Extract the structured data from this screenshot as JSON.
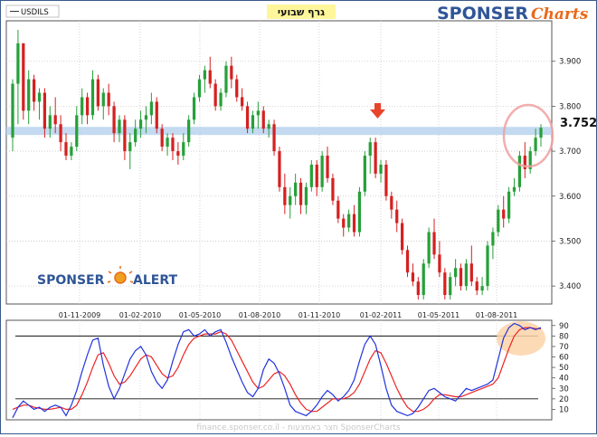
{
  "header": {
    "symbol": "USDILS",
    "title": "גרף שבועי",
    "brand_main": "SPONSER",
    "brand_accent": "Charts"
  },
  "alert_logo": {
    "left": "SPONSER",
    "right": "ALERT"
  },
  "footer": {
    "text": "finance.sponser.co.il - חצר באמצעות SponserCharts"
  },
  "colors": {
    "up": "#27a03a",
    "down": "#d42121",
    "stoch_k": "#2233dd",
    "stoch_d": "#ee2222",
    "resistance_band": "#b9d3ef",
    "marker": "#e8432b",
    "brand_blue": "#2f5597",
    "brand_orange": "#e86a1a"
  },
  "chart_data": [
    {
      "type": "candlestick",
      "series": [
        {
          "name": "USDILS"
        }
      ],
      "x_ticks": [
        "01-11-2009",
        "01-02-2010",
        "01-05-2010",
        "01-08-2010",
        "01-11-2010",
        "01-02-2011",
        "01-05-2011",
        "01-08-2011"
      ],
      "y_ticks": [
        "3.900",
        "3.800",
        "3.700",
        "3.600",
        "3.500",
        "3.400"
      ],
      "ylim": [
        3.36,
        3.99
      ],
      "last_price": "3.752",
      "resistance_level": 3.745,
      "grid": true,
      "candles": [
        [
          3.73,
          3.86,
          3.7,
          3.85
        ],
        [
          3.85,
          3.97,
          3.76,
          3.94
        ],
        [
          3.94,
          3.94,
          3.77,
          3.79
        ],
        [
          3.79,
          3.88,
          3.76,
          3.86
        ],
        [
          3.86,
          3.87,
          3.79,
          3.81
        ],
        [
          3.81,
          3.84,
          3.77,
          3.83
        ],
        [
          3.83,
          3.84,
          3.73,
          3.75
        ],
        [
          3.75,
          3.8,
          3.73,
          3.78
        ],
        [
          3.78,
          3.82,
          3.74,
          3.76
        ],
        [
          3.76,
          3.78,
          3.7,
          3.72
        ],
        [
          3.72,
          3.74,
          3.68,
          3.69
        ],
        [
          3.69,
          3.72,
          3.68,
          3.71
        ],
        [
          3.71,
          3.8,
          3.7,
          3.78
        ],
        [
          3.78,
          3.84,
          3.76,
          3.82
        ],
        [
          3.82,
          3.83,
          3.76,
          3.78
        ],
        [
          3.78,
          3.88,
          3.77,
          3.86
        ],
        [
          3.86,
          3.87,
          3.79,
          3.8
        ],
        [
          3.8,
          3.84,
          3.77,
          3.83
        ],
        [
          3.83,
          3.85,
          3.78,
          3.8
        ],
        [
          3.8,
          3.81,
          3.72,
          3.74
        ],
        [
          3.74,
          3.78,
          3.72,
          3.77
        ],
        [
          3.77,
          3.78,
          3.68,
          3.7
        ],
        [
          3.7,
          3.74,
          3.66,
          3.72
        ],
        [
          3.72,
          3.77,
          3.71,
          3.75
        ],
        [
          3.75,
          3.79,
          3.73,
          3.77
        ],
        [
          3.77,
          3.8,
          3.74,
          3.78
        ],
        [
          3.78,
          3.83,
          3.76,
          3.81
        ],
        [
          3.81,
          3.82,
          3.74,
          3.75
        ],
        [
          3.75,
          3.76,
          3.7,
          3.71
        ],
        [
          3.71,
          3.74,
          3.69,
          3.73
        ],
        [
          3.73,
          3.74,
          3.68,
          3.7
        ],
        [
          3.7,
          3.72,
          3.67,
          3.69
        ],
        [
          3.69,
          3.74,
          3.68,
          3.72
        ],
        [
          3.72,
          3.78,
          3.71,
          3.77
        ],
        [
          3.77,
          3.83,
          3.76,
          3.82
        ],
        [
          3.82,
          3.87,
          3.81,
          3.86
        ],
        [
          3.86,
          3.89,
          3.83,
          3.88
        ],
        [
          3.88,
          3.91,
          3.84,
          3.85
        ],
        [
          3.85,
          3.86,
          3.79,
          3.8
        ],
        [
          3.8,
          3.84,
          3.79,
          3.83
        ],
        [
          3.83,
          3.9,
          3.82,
          3.89
        ],
        [
          3.89,
          3.91,
          3.84,
          3.86
        ],
        [
          3.86,
          3.87,
          3.81,
          3.82
        ],
        [
          3.82,
          3.84,
          3.79,
          3.8
        ],
        [
          3.8,
          3.81,
          3.74,
          3.75
        ],
        [
          3.75,
          3.79,
          3.74,
          3.78
        ],
        [
          3.78,
          3.81,
          3.75,
          3.79
        ],
        [
          3.79,
          3.8,
          3.74,
          3.75
        ],
        [
          3.75,
          3.77,
          3.73,
          3.76
        ],
        [
          3.76,
          3.77,
          3.69,
          3.7
        ],
        [
          3.7,
          3.71,
          3.61,
          3.62
        ],
        [
          3.62,
          3.65,
          3.56,
          3.58
        ],
        [
          3.58,
          3.62,
          3.55,
          3.6
        ],
        [
          3.6,
          3.65,
          3.58,
          3.63
        ],
        [
          3.63,
          3.64,
          3.56,
          3.58
        ],
        [
          3.58,
          3.63,
          3.56,
          3.62
        ],
        [
          3.62,
          3.68,
          3.61,
          3.67
        ],
        [
          3.67,
          3.68,
          3.6,
          3.62
        ],
        [
          3.62,
          3.7,
          3.61,
          3.69
        ],
        [
          3.69,
          3.71,
          3.63,
          3.64
        ],
        [
          3.64,
          3.65,
          3.58,
          3.59
        ],
        [
          3.59,
          3.6,
          3.54,
          3.55
        ],
        [
          3.55,
          3.56,
          3.51,
          3.53
        ],
        [
          3.53,
          3.57,
          3.52,
          3.56
        ],
        [
          3.56,
          3.58,
          3.51,
          3.52
        ],
        [
          3.52,
          3.62,
          3.51,
          3.61
        ],
        [
          3.61,
          3.7,
          3.6,
          3.69
        ],
        [
          3.69,
          3.73,
          3.65,
          3.72
        ],
        [
          3.72,
          3.73,
          3.64,
          3.65
        ],
        [
          3.65,
          3.68,
          3.63,
          3.67
        ],
        [
          3.67,
          3.68,
          3.59,
          3.6
        ],
        [
          3.6,
          3.61,
          3.55,
          3.57
        ],
        [
          3.57,
          3.59,
          3.52,
          3.54
        ],
        [
          3.54,
          3.55,
          3.47,
          3.48
        ],
        [
          3.48,
          3.49,
          3.42,
          3.43
        ],
        [
          3.43,
          3.45,
          3.4,
          3.41
        ],
        [
          3.41,
          3.42,
          3.37,
          3.38
        ],
        [
          3.38,
          3.46,
          3.37,
          3.45
        ],
        [
          3.45,
          3.53,
          3.44,
          3.52
        ],
        [
          3.52,
          3.55,
          3.46,
          3.47
        ],
        [
          3.47,
          3.5,
          3.42,
          3.43
        ],
        [
          3.43,
          3.44,
          3.37,
          3.38
        ],
        [
          3.38,
          3.43,
          3.37,
          3.42
        ],
        [
          3.42,
          3.46,
          3.4,
          3.44
        ],
        [
          3.44,
          3.45,
          3.39,
          3.4
        ],
        [
          3.4,
          3.46,
          3.39,
          3.45
        ],
        [
          3.45,
          3.49,
          3.4,
          3.41
        ],
        [
          3.41,
          3.42,
          3.38,
          3.39
        ],
        [
          3.39,
          3.42,
          3.38,
          3.4
        ],
        [
          3.4,
          3.5,
          3.39,
          3.49
        ],
        [
          3.49,
          3.53,
          3.46,
          3.52
        ],
        [
          3.52,
          3.58,
          3.51,
          3.57
        ],
        [
          3.57,
          3.6,
          3.53,
          3.55
        ],
        [
          3.55,
          3.62,
          3.54,
          3.61
        ],
        [
          3.61,
          3.64,
          3.6,
          3.62
        ],
        [
          3.62,
          3.7,
          3.61,
          3.69
        ],
        [
          3.69,
          3.72,
          3.64,
          3.66
        ],
        [
          3.66,
          3.71,
          3.65,
          3.7
        ],
        [
          3.7,
          3.75,
          3.69,
          3.73
        ],
        [
          3.73,
          3.76,
          3.71,
          3.752
        ]
      ]
    },
    {
      "type": "line",
      "y_ticks": [
        "90",
        "80",
        "70",
        "60",
        "50",
        "40",
        "30",
        "20",
        "10"
      ],
      "ylim": [
        0,
        95
      ],
      "reference_lines": [
        80,
        20
      ],
      "series": [
        {
          "name": "",
          "values": [
            2,
            12,
            18,
            14,
            10,
            12,
            8,
            12,
            14,
            12,
            4,
            14,
            28,
            46,
            62,
            76,
            78,
            52,
            32,
            20,
            30,
            44,
            58,
            66,
            70,
            62,
            46,
            36,
            30,
            38,
            56,
            72,
            84,
            86,
            80,
            82,
            86,
            80,
            84,
            86,
            74,
            60,
            48,
            36,
            26,
            22,
            30,
            48,
            58,
            54,
            44,
            30,
            14,
            8,
            6,
            4,
            8,
            14,
            22,
            28,
            24,
            18,
            22,
            28,
            38,
            56,
            72,
            80,
            72,
            52,
            30,
            14,
            8,
            6,
            4,
            6,
            12,
            20,
            28,
            30,
            26,
            22,
            20,
            18,
            24,
            30,
            28,
            30,
            32,
            34,
            38,
            58,
            78,
            88,
            92,
            90,
            86,
            88,
            86,
            88
          ]
        },
        {
          "name": "",
          "values": [
            10,
            12,
            14,
            14,
            12,
            11,
            10,
            10,
            11,
            12,
            10,
            10,
            14,
            24,
            36,
            50,
            62,
            64,
            54,
            42,
            34,
            36,
            42,
            50,
            58,
            62,
            60,
            52,
            44,
            40,
            42,
            50,
            62,
            72,
            78,
            80,
            82,
            82,
            82,
            84,
            82,
            76,
            66,
            56,
            46,
            36,
            30,
            32,
            38,
            44,
            46,
            42,
            34,
            24,
            16,
            10,
            8,
            8,
            12,
            16,
            20,
            20,
            20,
            22,
            26,
            34,
            46,
            58,
            66,
            64,
            54,
            42,
            30,
            20,
            12,
            8,
            8,
            10,
            14,
            20,
            24,
            24,
            23,
            22,
            22,
            24,
            26,
            28,
            30,
            32,
            34,
            40,
            54,
            68,
            80,
            86,
            88,
            88,
            87,
            87
          ]
        }
      ]
    }
  ]
}
